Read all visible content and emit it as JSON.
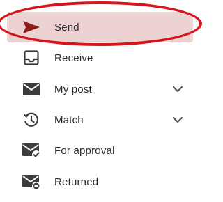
{
  "menu": {
    "items": [
      {
        "label": "Send",
        "icon": "send-icon",
        "selected": true
      },
      {
        "label": "Receive",
        "icon": "inbox-icon"
      },
      {
        "label": "My post",
        "icon": "mail-icon",
        "expandable": true
      },
      {
        "label": "Match",
        "icon": "history-clock-icon",
        "expandable": true
      },
      {
        "label": "For approval",
        "icon": "mail-check-icon"
      },
      {
        "label": "Returned",
        "icon": "mail-returned-icon"
      }
    ]
  },
  "colors": {
    "accent": "#8b1a1a",
    "selected_bg": "#ecd2d3",
    "annotation_ring": "#d6151b",
    "icon": "#3c3c3c",
    "text": "#2b2b2b"
  }
}
